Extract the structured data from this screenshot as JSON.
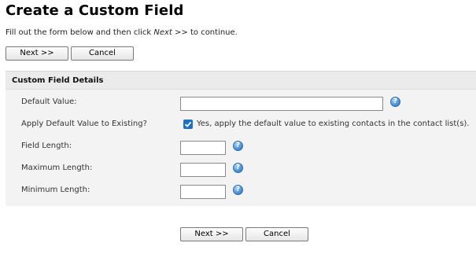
{
  "page": {
    "title": "Create a Custom Field",
    "intro_before": "Fill out the form below and then click ",
    "intro_em": "Next >>",
    "intro_after": " to continue."
  },
  "buttons": {
    "next_label": "Next >>",
    "cancel_label": "Cancel"
  },
  "panel": {
    "title": "Custom Field Details",
    "fields": {
      "default_value": {
        "label": "Default Value:",
        "value": ""
      },
      "apply_default": {
        "label": "Apply Default Value to Existing?",
        "checked": true,
        "checkbox_text": "Yes, apply the default value to existing contacts in the contact list(s)."
      },
      "field_length": {
        "label": "Field Length:",
        "value": ""
      },
      "maximum_length": {
        "label": "Maximum Length:",
        "value": ""
      },
      "minimum_length": {
        "label": "Minimum Length:",
        "value": ""
      }
    }
  },
  "icons": {
    "help": "help-icon",
    "check": "checkmark-icon"
  },
  "colors": {
    "accent": "#1f6fc5",
    "panel_bg": "#f3f3f3",
    "help_blue": "#3f86cf"
  }
}
